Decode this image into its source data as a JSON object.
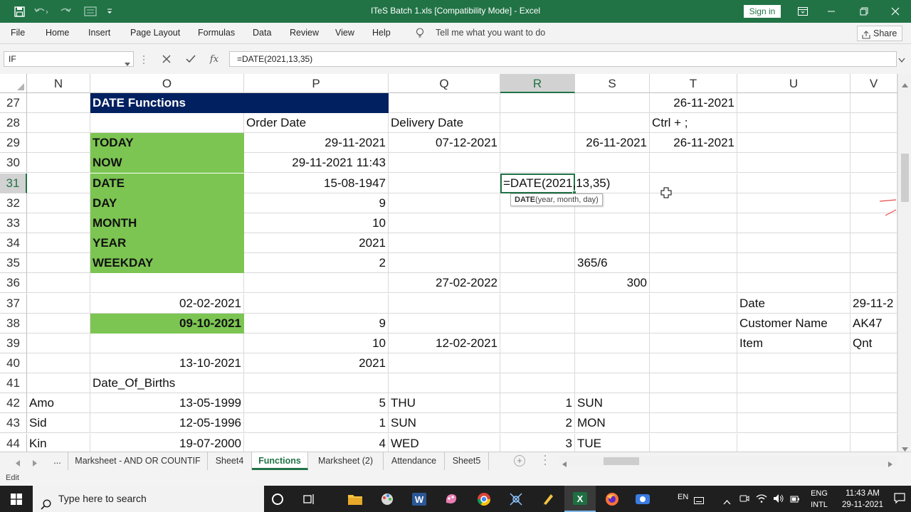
{
  "window": {
    "title": "ITeS Batch 1.xls  [Compatibility Mode]  -  Excel",
    "sign_in": "Sign in"
  },
  "ribbon": {
    "tabs": [
      "File",
      "Home",
      "Insert",
      "Page Layout",
      "Formulas",
      "Data",
      "Review",
      "View",
      "Help"
    ],
    "tell_me": "Tell me what you want to do",
    "share": "Share"
  },
  "formula_bar": {
    "name_box": "IF",
    "fx": "fx",
    "formula": "=DATE(2021,13,35)"
  },
  "grid": {
    "columns": [
      "N",
      "O",
      "P",
      "Q",
      "R",
      "S",
      "T",
      "U",
      "V"
    ],
    "active_column": "R",
    "rows": [
      "27",
      "28",
      "29",
      "30",
      "31",
      "32",
      "33",
      "34",
      "35",
      "36",
      "37",
      "38",
      "39",
      "40",
      "41",
      "42",
      "43",
      "44"
    ],
    "active_row": "31",
    "cells": {
      "O27": "DATE Functions",
      "T27": "26-11-2021",
      "P28": "Order Date",
      "Q28": "Delivery Date",
      "T28": "Ctrl + ;",
      "O29": "TODAY",
      "P29": "29-11-2021",
      "Q29": "07-12-2021",
      "S29": "26-11-2021",
      "T29": "26-11-2021",
      "O30": "NOW",
      "P30": "29-11-2021 11:43",
      "O31": "DATE",
      "P31": "15-08-1947",
      "R31": "=DATE(2021,13,35)",
      "O32": "DAY",
      "P32": "9",
      "O33": "MONTH",
      "P33": "10",
      "O34": "YEAR",
      "P34": "2021",
      "O35": "WEEKDAY",
      "P35": "2",
      "S35": "365/6",
      "Q36": "27-02-2022",
      "S36": "300",
      "O37": "02-02-2021",
      "U37": "Date",
      "V37": "29-11-2",
      "O38": "09-10-2021",
      "P38": "9",
      "U38": "Customer Name",
      "V38": "AK47",
      "P39": "10",
      "Q39": "12-02-2021",
      "U39": "Item",
      "V39": "Qnt",
      "O40": "13-10-2021",
      "P40": "2021",
      "O41": "Date_Of_Births",
      "N42": "Amo",
      "O42": "13-05-1999",
      "P42": "5",
      "Q42": "THU",
      "R42": "1",
      "S42": "SUN",
      "N43": "Sid",
      "O43": "12-05-1996",
      "P43": "1",
      "Q43": "SUN",
      "R43": "2",
      "S43": "MON",
      "N44": "Kin",
      "O44": "19-07-2000",
      "P44": "4",
      "Q44": "WED",
      "R44": "3",
      "S44": "TUE"
    },
    "tooltip_fn": "DATE",
    "tooltip_args": "(year, month, day)"
  },
  "sheets": {
    "overflow": "...",
    "tabs": [
      "Marksheet - AND OR COUNTIF",
      "Sheet4",
      "Functions",
      "Marksheet  (2)",
      "Attendance",
      "Sheet5"
    ],
    "active": "Functions"
  },
  "status": {
    "mode": "Edit"
  },
  "taskbar": {
    "search_placeholder": "Type here to search",
    "lang_short": "EN",
    "lang": "ENG",
    "layout": "INTL",
    "time": "11:43 AM",
    "date": "29-11-2021"
  },
  "colors": {
    "excel_green": "#217346",
    "navy_fill": "#002060",
    "green_fill": "#7cc552"
  }
}
